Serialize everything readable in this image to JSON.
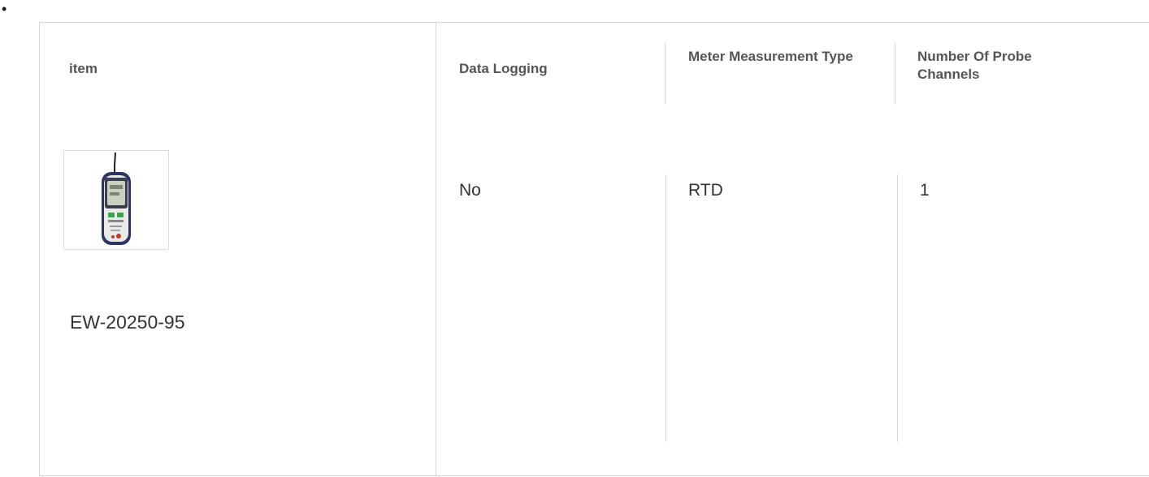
{
  "bullet": "•",
  "table": {
    "item_header": "item",
    "columns": [
      {
        "header": "Data Logging",
        "value": "No"
      },
      {
        "header": "Meter Measurement Type",
        "value": "RTD"
      },
      {
        "header": "Number Of Probe Channels",
        "value": "1"
      }
    ],
    "product": {
      "sku": "EW-20250-95",
      "image_icon": "handheld-thermometer-icon"
    }
  },
  "colors": {
    "border": "#d6d6d6",
    "header_text": "#555555",
    "body_text": "#333333",
    "device_body": "#2c3566"
  }
}
